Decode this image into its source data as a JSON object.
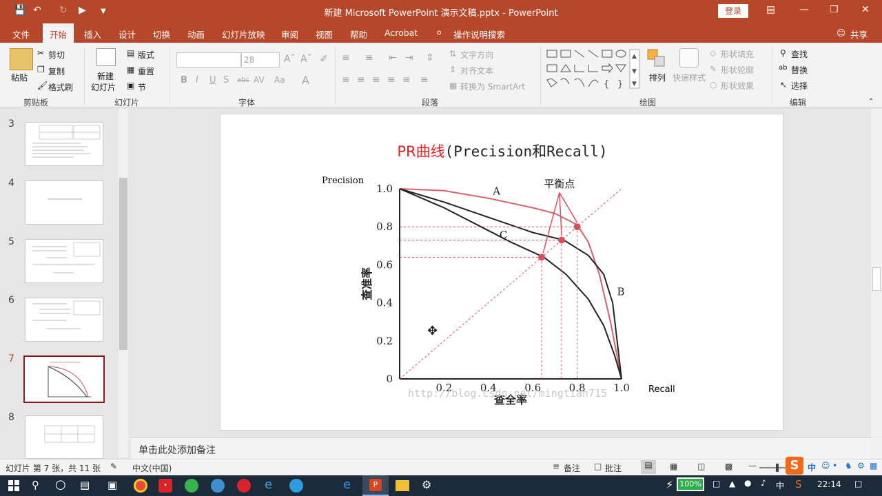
{
  "window": {
    "title": "新建 Microsoft PowerPoint 演示文稿.pptx  -  PowerPoint",
    "login": "登录"
  },
  "menu": {
    "tabs": [
      "文件",
      "开始",
      "插入",
      "设计",
      "切换",
      "动画",
      "幻灯片放映",
      "审阅",
      "视图",
      "帮助",
      "Acrobat"
    ],
    "search": "操作说明搜索",
    "share": "共享"
  },
  "ribbon": {
    "clipboard": {
      "paste": "粘贴",
      "cut": "剪切",
      "copy": "复制",
      "format_painter": "格式刷",
      "label": "剪贴板"
    },
    "slides": {
      "new_slide": "新建",
      "new_slide2": "幻灯片",
      "layout": "版式",
      "reset": "重置",
      "section": "节",
      "label": "幻灯片"
    },
    "font": {
      "size": "28",
      "label": "字体"
    },
    "paragraph": {
      "text_direction": "文字方向",
      "align_text": "对齐文本",
      "smartart": "转换为 SmartArt",
      "label": "段落"
    },
    "drawing": {
      "arrange": "排列",
      "quick_styles": "快速样式",
      "fill": "形状填充",
      "outline": "形状轮廓",
      "effects": "形状效果",
      "label": "绘图"
    },
    "editing": {
      "find": "查找",
      "replace": "替换",
      "select": "选择",
      "label": "编辑"
    }
  },
  "thumbnails": [
    {
      "num": "3"
    },
    {
      "num": "4"
    },
    {
      "num": "5"
    },
    {
      "num": "6"
    },
    {
      "num": "7"
    },
    {
      "num": "8"
    }
  ],
  "slide": {
    "title_red": "PR曲线",
    "title_black": "(Precision和Recall)",
    "ylabel_en": "Precision",
    "xlabel_en": "Recall",
    "ylabel_cn": "查准率",
    "xlabel_cn": "查全率",
    "balance_label": "平衡点",
    "watermark": "http://blog.csdn.net/mingtian715",
    "curve_labels": [
      "A",
      "B",
      "C"
    ]
  },
  "chart_data": {
    "type": "line",
    "xlabel": "查全率",
    "ylabel": "查准率",
    "xlim": [
      0,
      1.0
    ],
    "ylim": [
      0,
      1.0
    ],
    "x_ticks": [
      "0.2",
      "0.4",
      "0.6",
      "0.8",
      "1.0"
    ],
    "y_ticks": [
      "0",
      "0.2",
      "0.4",
      "0.6",
      "0.8",
      "1.0"
    ],
    "series": [
      {
        "name": "A",
        "x": [
          0,
          0.2,
          0.4,
          0.6,
          0.7,
          0.8,
          0.85,
          0.9,
          0.95,
          1.0
        ],
        "y": [
          1.0,
          0.99,
          0.95,
          0.9,
          0.87,
          0.81,
          0.72,
          0.55,
          0.3,
          0.0
        ]
      },
      {
        "name": "B",
        "x": [
          0,
          0.2,
          0.4,
          0.6,
          0.74,
          0.85,
          0.92,
          0.96,
          0.98,
          1.0
        ],
        "y": [
          1.0,
          0.93,
          0.85,
          0.77,
          0.73,
          0.65,
          0.55,
          0.4,
          0.2,
          0.0
        ]
      },
      {
        "name": "C",
        "x": [
          0,
          0.2,
          0.4,
          0.5,
          0.65,
          0.75,
          0.85,
          0.92,
          0.97,
          1.0
        ],
        "y": [
          1.0,
          0.9,
          0.78,
          0.72,
          0.64,
          0.55,
          0.42,
          0.28,
          0.12,
          0.0
        ]
      }
    ],
    "balance_points": [
      [
        0.64,
        0.64
      ],
      [
        0.73,
        0.73
      ],
      [
        0.8,
        0.8
      ]
    ]
  },
  "notes": {
    "placeholder": "单击此处添加备注"
  },
  "status": {
    "slide_info": "幻灯片 第 7 张，共 11 张",
    "language": "中文(中国)",
    "notes": "备注",
    "comments": "批注",
    "ime": "中"
  },
  "taskbar": {
    "battery": "100%",
    "ime": "中",
    "time": "22:14"
  }
}
